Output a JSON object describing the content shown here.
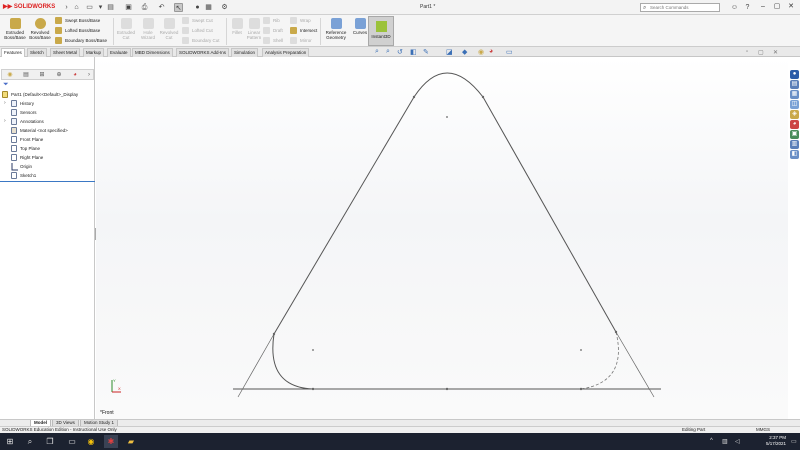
{
  "app": {
    "brand_name": "SOLIDWORKS",
    "doc_title": "Part1 *"
  },
  "search": {
    "placeholder": "Search Commands"
  },
  "command_manager": {
    "big_buttons": [
      {
        "label": "Extruded Boss/Base",
        "enabled": true
      },
      {
        "label": "Revolved Boss/Base",
        "enabled": true
      },
      {
        "label": "Extruded Cut",
        "enabled": false
      },
      {
        "label": "Hole Wizard",
        "enabled": false
      },
      {
        "label": "Revolved Cut",
        "enabled": false
      },
      {
        "label": "Fillet",
        "enabled": false
      },
      {
        "label": "Linear Pattern",
        "enabled": false
      },
      {
        "label": "Reference Geometry",
        "enabled": true
      },
      {
        "label": "Curves",
        "enabled": true
      },
      {
        "label": "Instant3D",
        "enabled": true
      }
    ],
    "boss_group": [
      "Swept Boss/Base",
      "Lofted Boss/Base",
      "Boundary Boss/Base"
    ],
    "cut_group": [
      "Swept Cut",
      "Lofted Cut",
      "Boundary Cut"
    ],
    "misc_group": [
      "Rib",
      "Draft",
      "Shell",
      "Wrap",
      "Intersect",
      "Mirror"
    ]
  },
  "tabs": [
    "Features",
    "Sketch",
    "Sheet Metal",
    "Markup",
    "Evaluate",
    "MBD Dimensions",
    "SOLIDWORKS Add-Ins",
    "Simulation",
    "Analysis Preparation"
  ],
  "tree": {
    "root": "Part1  (Default<<Default>_Display",
    "items": [
      "History",
      "Sensors",
      "Annotations",
      "Material <not specified>",
      "Front Plane",
      "Top Plane",
      "Right Plane",
      "Origin",
      "Sketch1"
    ]
  },
  "viewport": {
    "view_label": "*Front"
  },
  "bottom_tabs": [
    "Model",
    "3D Views",
    "Motion Study 1"
  ],
  "status": {
    "left": "SOLIDWORKS Education Edition - Instructional Use Only",
    "mode": "Editing Part",
    "units": "MMGS"
  },
  "taskbar": {
    "time": "2:37 PM",
    "date": "5/17/2021"
  },
  "colors": {
    "accent": "#3b78c4",
    "brand": "#d22222",
    "sketch_line": "#555555"
  }
}
